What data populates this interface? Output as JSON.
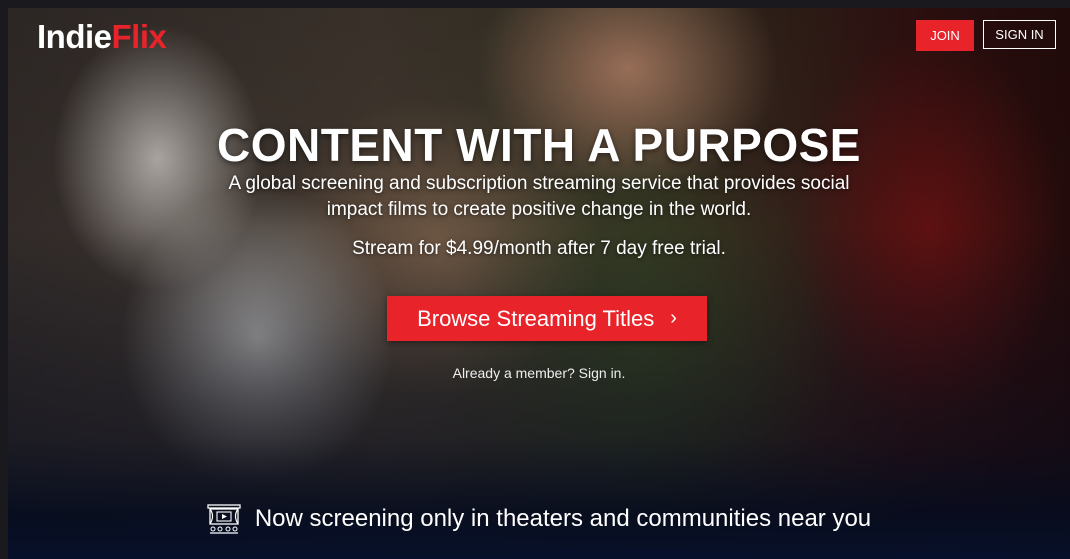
{
  "header": {
    "logo_part1": "Indie",
    "logo_part2": "Flix",
    "join_label": "JOIN",
    "signin_label": "SIGN IN"
  },
  "hero": {
    "title": "CONTENT WITH A PURPOSE",
    "subtitle": "A global screening and subscription streaming service that provides social impact films to create positive change in the world.",
    "price_text": "Stream for $4.99/month after 7 day free trial.",
    "browse_label": "Browse Streaming Titles",
    "browse_chevron": "›",
    "member_link": "Already a member? Sign in."
  },
  "footer_banner": {
    "icon": "theater-icon",
    "text": "Now screening only in theaters and communities near you"
  },
  "colors": {
    "brand_red": "#e8232a",
    "text": "#ffffff"
  }
}
